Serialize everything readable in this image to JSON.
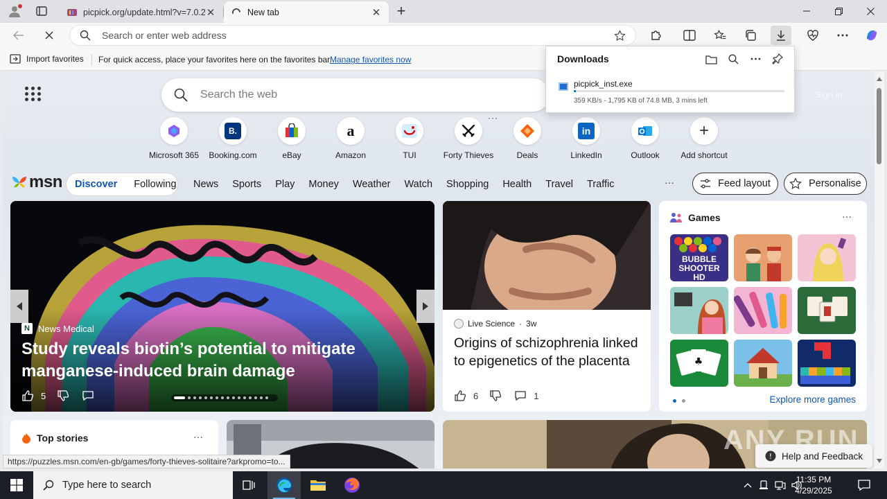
{
  "browser": {
    "tabs": [
      {
        "title": "picpick.org/update.html?v=7.0.2",
        "close": "✕"
      },
      {
        "title": "New tab",
        "close": "✕"
      }
    ],
    "new_tab": "+",
    "address_placeholder": "Search or enter web address"
  },
  "favorites_bar": {
    "import_label": "Import favorites",
    "message": "For quick access, place your favorites here on the favorites bar.",
    "manage_link": "Manage favorites now"
  },
  "downloads": {
    "title": "Downloads",
    "file_name": "picpick_inst.exe",
    "progress": 0.01,
    "status": "359 KB/s - 1,795 KB of 74.8 MB, 3 mins left"
  },
  "newtab": {
    "search_placeholder": "Search the web",
    "signin": "Sign in",
    "shortcuts": [
      {
        "label": "Microsoft 365",
        "icon": "microsoft-365-icon"
      },
      {
        "label": "Booking.com",
        "icon": "B."
      },
      {
        "label": "eBay",
        "icon": "ebay-icon"
      },
      {
        "label": "Amazon",
        "icon": "a"
      },
      {
        "label": "TUI",
        "icon": "tui-icon"
      },
      {
        "label": "Forty Thieves",
        "icon": "crossed-swords-icon"
      },
      {
        "label": "Deals",
        "icon": "deals-icon"
      },
      {
        "label": "LinkedIn",
        "icon": "in"
      },
      {
        "label": "Outlook",
        "icon": "outlook-icon"
      },
      {
        "label": "Add shortcut",
        "icon": "+"
      }
    ],
    "shortcut_more": "···"
  },
  "msn": {
    "logo": "msn",
    "segments": [
      "Discover",
      "Following"
    ],
    "nav": [
      "News",
      "Sports",
      "Play",
      "Money",
      "Weather",
      "Watch",
      "Shopping",
      "Health",
      "Travel",
      "Traffic"
    ],
    "nav_more": "···",
    "feed_layout": "Feed layout",
    "personalise": "Personalise"
  },
  "hero": {
    "source": "News Medical",
    "source_logo": "N",
    "headline": "Study reveals biotin’s potential to mitigate manganese-induced brain damage",
    "likes": "5",
    "slide_count": 16
  },
  "card2": {
    "source": "Live Science",
    "age": "3w",
    "headline": "Origins of schizophrenia linked to epigenetics of the placenta",
    "likes": "6",
    "comments": "1"
  },
  "games": {
    "title": "Games",
    "more": "···",
    "tile1_text": "BUBBLE SHOOTER HD",
    "explore": "Explore more games"
  },
  "top_stories": {
    "title": "Top stories",
    "more": "···"
  },
  "help": "Help and Feedback",
  "watermark": "ANY RUN",
  "status_url": "https://puzzles.msn.com/en-gb/games/forty-thieves-solitaire?arkpromo=to...",
  "taskbar": {
    "search_placeholder": "Type here to search",
    "time": "11:35 PM",
    "date": "4/29/2025"
  },
  "colors": {
    "accent": "#0f55b5",
    "taskbar": "#1c1f26",
    "progress": "#0f6cbd"
  }
}
